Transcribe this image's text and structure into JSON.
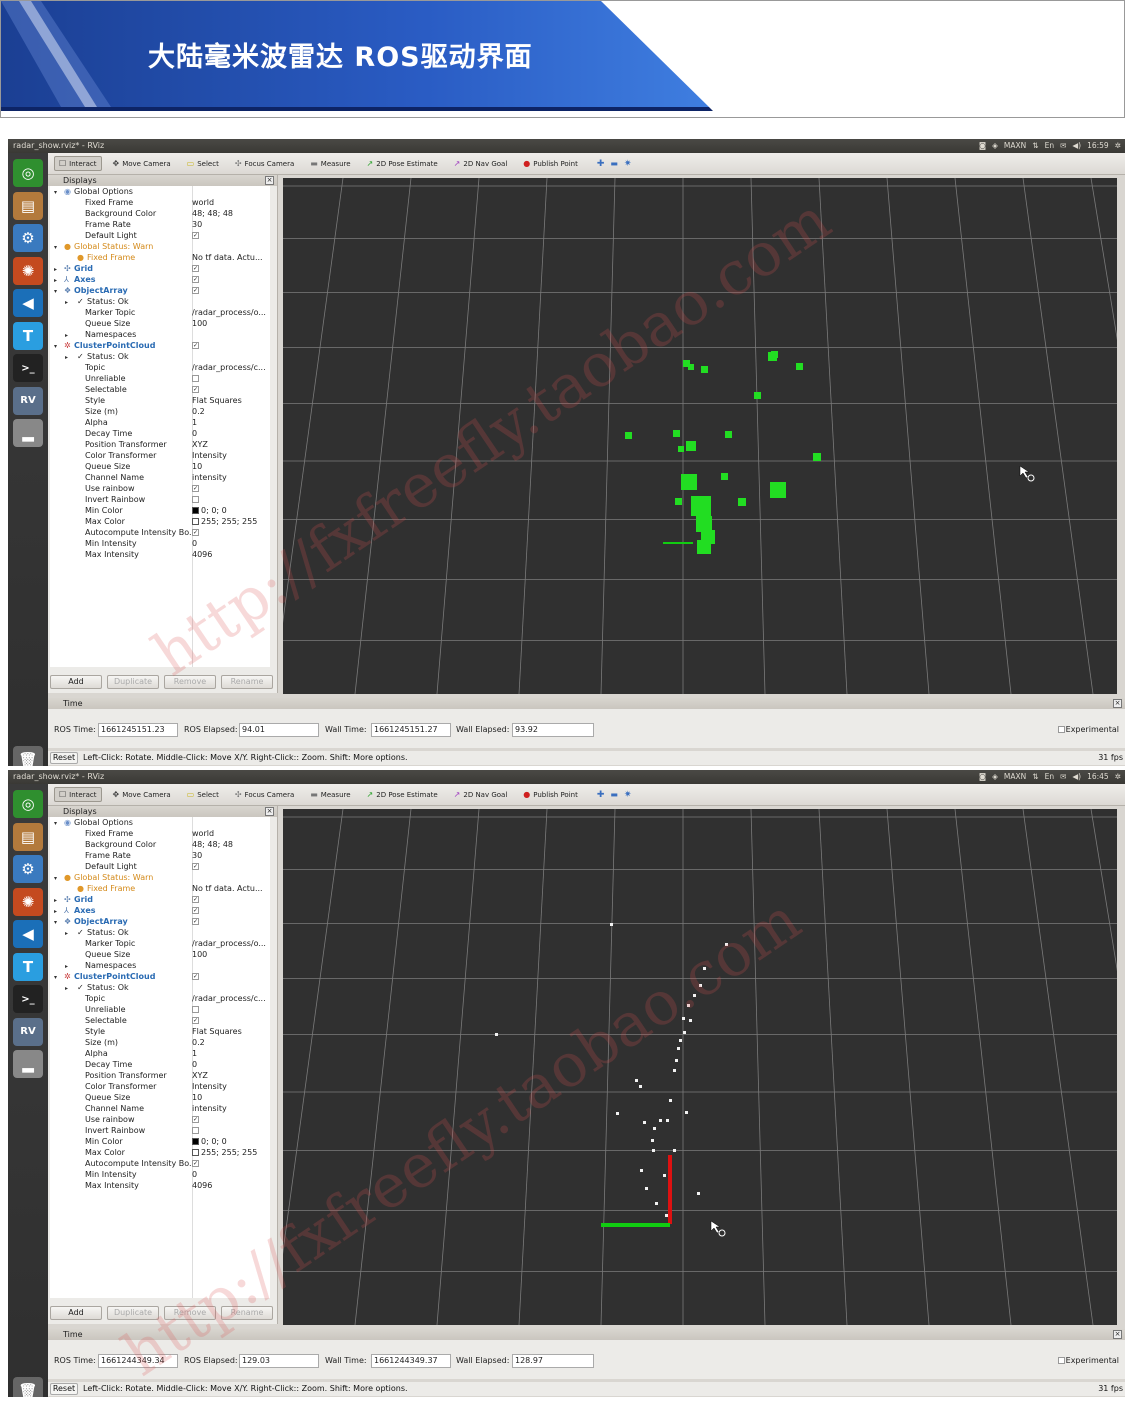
{
  "banner": {
    "title": "大陆毫米波雷达 ROS驱动界面"
  },
  "windows": [
    {
      "title": "radar_show.rviz* - RViz",
      "tray": {
        "user": "MAXN",
        "time": "16:59"
      },
      "toolbar": [
        "Interact",
        "Move Camera",
        "Select",
        "Focus Camera",
        "Measure",
        "2D Pose Estimate",
        "2D Nav Goal",
        "Publish Point"
      ],
      "displays_header": "Displays",
      "time_header": "Time",
      "buttons": {
        "add": "Add",
        "duplicate": "Duplicate",
        "remove": "Remove",
        "rename": "Rename"
      },
      "time": {
        "ros_time_label": "ROS Time:",
        "ros_time": "1661245151.23",
        "ros_elapsed_label": "ROS Elapsed:",
        "ros_elapsed": "94.01",
        "wall_time_label": "Wall Time:",
        "wall_time": "1661245151.27",
        "wall_elapsed_label": "Wall Elapsed:",
        "wall_elapsed": "93.92",
        "experimental": "Experimental"
      },
      "status": {
        "reset": "Reset",
        "help": "Left-Click: Rotate. Middle-Click: Move X/Y. Right-Click:: Zoom. Shift: More options.",
        "fps": "31 fps"
      }
    },
    {
      "title": "radar_show.rviz* - RViz",
      "tray": {
        "user": "MAXN",
        "time": "16:45"
      },
      "toolbar": [
        "Interact",
        "Move Camera",
        "Select",
        "Focus Camera",
        "Measure",
        "2D Pose Estimate",
        "2D Nav Goal",
        "Publish Point"
      ],
      "displays_header": "Displays",
      "time_header": "Time",
      "buttons": {
        "add": "Add",
        "duplicate": "Duplicate",
        "remove": "Remove",
        "rename": "Rename"
      },
      "time": {
        "ros_time_label": "ROS Time:",
        "ros_time": "1661244349.34",
        "ros_elapsed_label": "ROS Elapsed:",
        "ros_elapsed": "129.03",
        "wall_time_label": "Wall Time:",
        "wall_time": "1661244349.37",
        "wall_elapsed_label": "Wall Elapsed:",
        "wall_elapsed": "128.97",
        "experimental": "Experimental"
      },
      "status": {
        "reset": "Reset",
        "help": "Left-Click: Rotate. Middle-Click: Move X/Y. Right-Click:: Zoom. Shift: More options.",
        "fps": "31 fps"
      }
    }
  ],
  "tree_rows": [
    {
      "k": "Global Options",
      "v": ""
    },
    {
      "k": "Fixed Frame",
      "v": "world"
    },
    {
      "k": "Background Color",
      "v": "48; 48; 48"
    },
    {
      "k": "Frame Rate",
      "v": "30"
    },
    {
      "k": "Default Light",
      "v": "✓"
    },
    {
      "k": "Global Status: Warn",
      "v": ""
    },
    {
      "k": "Fixed Frame",
      "v": "No tf data.  Actu..."
    },
    {
      "k": "Grid",
      "v": "✓"
    },
    {
      "k": "Axes",
      "v": "✓"
    },
    {
      "k": "ObjectArray",
      "v": "✓"
    },
    {
      "k": "Status: Ok",
      "v": ""
    },
    {
      "k": "Marker Topic",
      "v": "/radar_process/o..."
    },
    {
      "k": "Queue Size",
      "v": "100"
    },
    {
      "k": "Namespaces",
      "v": ""
    },
    {
      "k": "ClusterPointCloud",
      "v": "✓"
    },
    {
      "k": "Status: Ok",
      "v": ""
    },
    {
      "k": "Topic",
      "v": "/radar_process/c..."
    },
    {
      "k": "Unreliable",
      "v": ""
    },
    {
      "k": "Selectable",
      "v": "✓"
    },
    {
      "k": "Style",
      "v": "Flat Squares"
    },
    {
      "k": "Size (m)",
      "v": "0.2"
    },
    {
      "k": "Alpha",
      "v": "1"
    },
    {
      "k": "Decay Time",
      "v": "0"
    },
    {
      "k": "Position Transformer",
      "v": "XYZ"
    },
    {
      "k": "Color Transformer",
      "v": "Intensity"
    },
    {
      "k": "Queue Size",
      "v": "10"
    },
    {
      "k": "Channel Name",
      "v": "intensity"
    },
    {
      "k": "Use rainbow",
      "v": "✓"
    },
    {
      "k": "Invert Rainbow",
      "v": ""
    },
    {
      "k": "Min Color",
      "v": "0; 0; 0"
    },
    {
      "k": "Max Color",
      "v": "255; 255; 255"
    },
    {
      "k": "Autocompute Intensity Bo...",
      "v": "✓"
    },
    {
      "k": "Min Intensity",
      "v": "0"
    },
    {
      "k": "Max Intensity",
      "v": "4096"
    }
  ],
  "watermark": "http://fxfreefly.taobao.com",
  "colors": {
    "grid_bg": "#303030",
    "points_green": "#22dd22",
    "axis_red": "#dd1111",
    "axis_green": "#11cc11",
    "banner_blue": "#1a3e8c"
  }
}
